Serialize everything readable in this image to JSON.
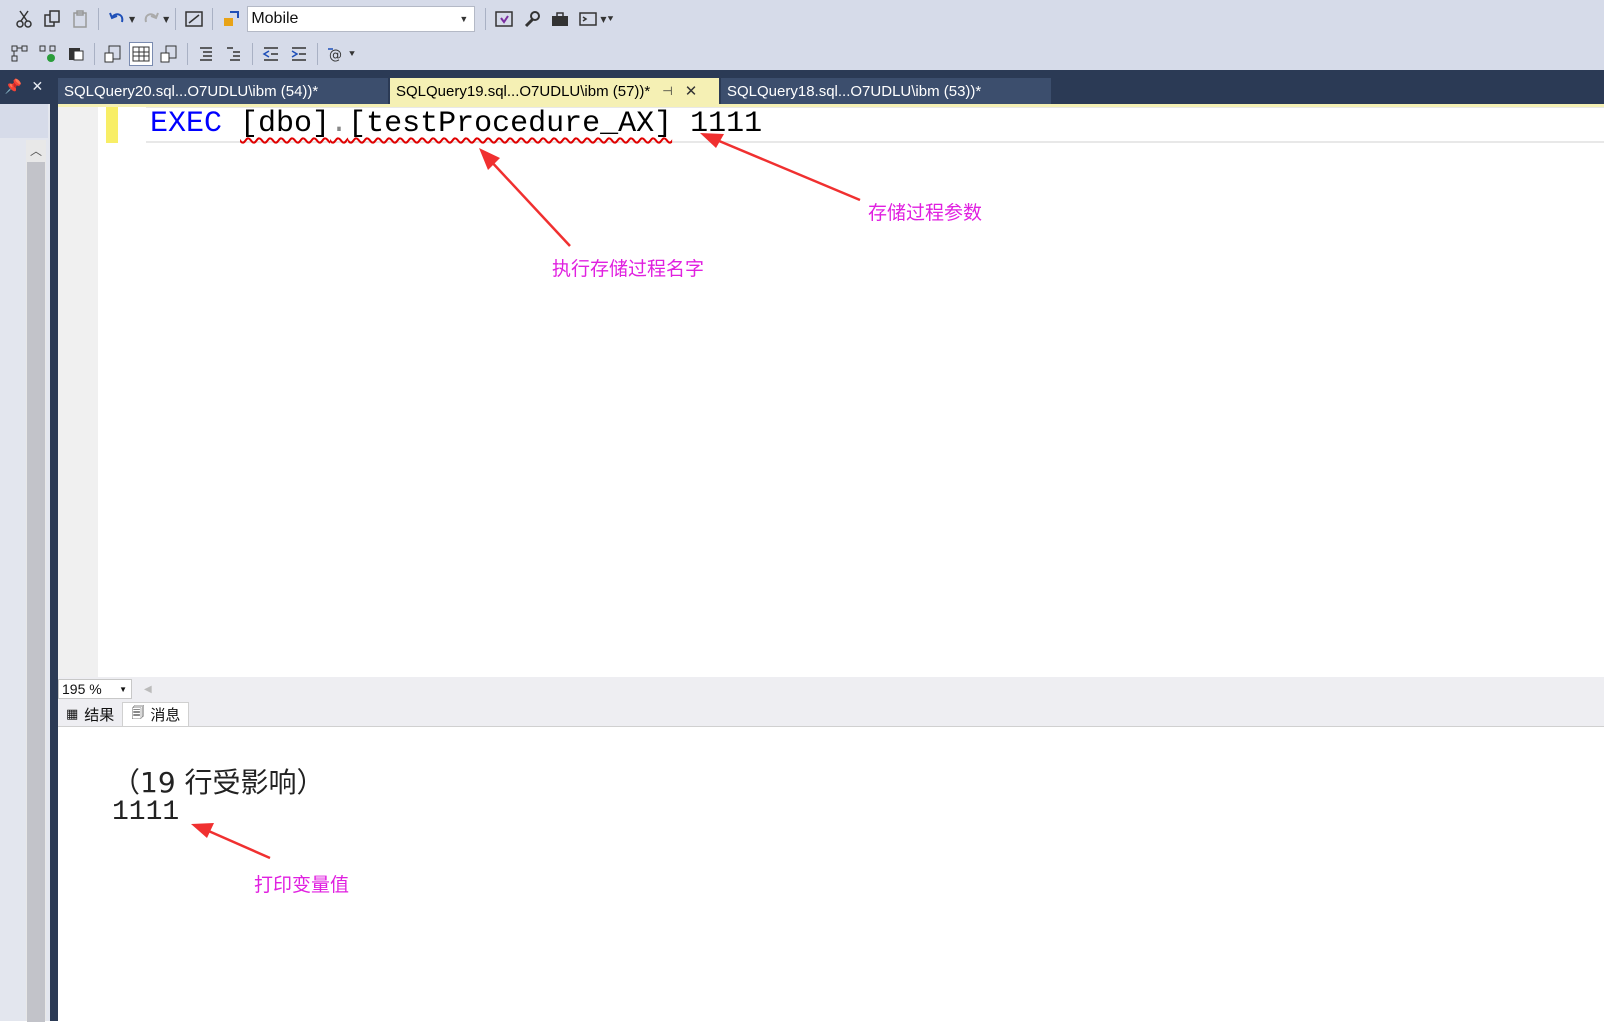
{
  "toolbar": {
    "row1_icons": [
      "cut-icon",
      "copy-icon",
      "paste-icon",
      "undo-icon",
      "redo-icon",
      "object-explorer-icon",
      "solution-icon",
      "database-icon"
    ],
    "database_combo": "Mobile",
    "row1_right_icons": [
      "vs-logo-icon",
      "wrench-icon",
      "toolbox-icon",
      "terminal-icon"
    ]
  },
  "tabs": [
    {
      "label": "SQLQuery20.sql...O7UDLU\\ibm (54))*"
    },
    {
      "label": "SQLQuery19.sql...O7UDLU\\ibm (57))*",
      "active": true
    },
    {
      "label": "SQLQuery18.sql...O7UDLU\\ibm (53))*"
    }
  ],
  "editor": {
    "keyword": "EXEC",
    "schema": "[dbo]",
    "dot": ".",
    "procedure": "[testProcedure_AX]",
    "argument": "1111"
  },
  "zoom": "195 %",
  "result_tabs": {
    "results": "结果",
    "messages": "消息"
  },
  "messages": {
    "line1": "（19 行受影响）",
    "line2": "1111"
  },
  "annotations": {
    "param_note": "存储过程参数",
    "procname_note": "执行存储过程名字",
    "print_note": "打印变量值"
  },
  "colors": {
    "keyword": "#0000ff",
    "annotation": "#e020e0",
    "arrow": "#f03030",
    "tab_strip": "#2b3a55",
    "active_tab": "#f5f0b4"
  }
}
